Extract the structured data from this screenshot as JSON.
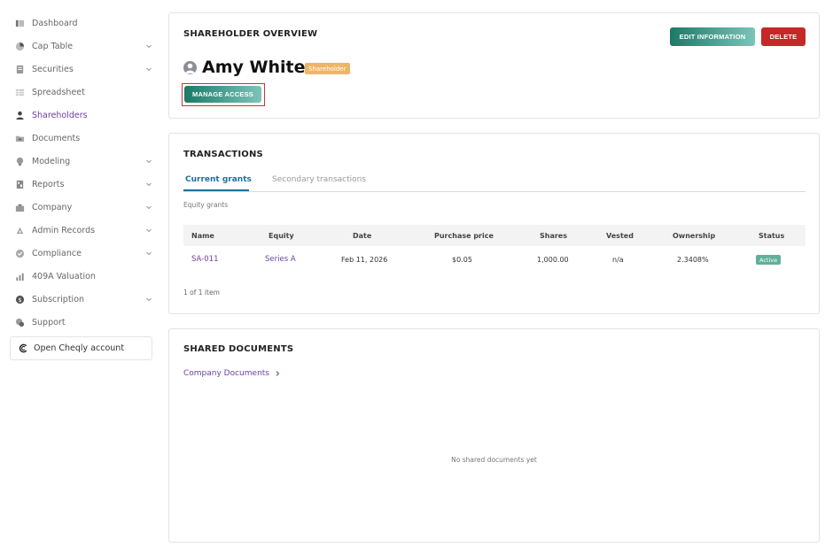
{
  "sidebar": {
    "items": [
      {
        "label": "Dashboard",
        "icon": "dashboard-icon",
        "chevron": false,
        "active": false
      },
      {
        "label": "Cap Table",
        "icon": "pie-chart-icon",
        "chevron": true,
        "active": false
      },
      {
        "label": "Securities",
        "icon": "securities-icon",
        "chevron": true,
        "active": false
      },
      {
        "label": "Spreadsheet",
        "icon": "spreadsheet-icon",
        "chevron": false,
        "active": false
      },
      {
        "label": "Shareholders",
        "icon": "person-icon",
        "chevron": false,
        "active": true
      },
      {
        "label": "Documents",
        "icon": "folder-icon",
        "chevron": false,
        "active": false
      },
      {
        "label": "Modeling",
        "icon": "lightbulb-icon",
        "chevron": true,
        "active": false
      },
      {
        "label": "Reports",
        "icon": "reports-icon",
        "chevron": true,
        "active": false
      },
      {
        "label": "Company",
        "icon": "company-icon",
        "chevron": true,
        "active": false
      },
      {
        "label": "Admin Records",
        "icon": "admin-records-icon",
        "chevron": true,
        "active": false
      },
      {
        "label": "Compliance",
        "icon": "compliance-icon",
        "chevron": true,
        "active": false
      },
      {
        "label": "409A Valuation",
        "icon": "valuation-icon",
        "chevron": false,
        "active": false
      },
      {
        "label": "Subscription",
        "icon": "subscription-icon",
        "chevron": true,
        "active": false
      },
      {
        "label": "Support",
        "icon": "support-icon",
        "chevron": false,
        "active": false
      }
    ],
    "open_account_label": "Open Cheqly account"
  },
  "overview": {
    "title": "SHAREHOLDER OVERVIEW",
    "edit_label": "EDIT INFORMATION",
    "delete_label": "DELETE",
    "name": "Amy White",
    "role_badge": "Shareholder",
    "manage_label": "MANAGE ACCESS"
  },
  "transactions": {
    "title": "TRANSACTIONS",
    "tabs": [
      "Current grants",
      "Secondary transactions"
    ],
    "section_label": "Equity grants",
    "columns": [
      "Name",
      "Equity",
      "Date",
      "Purchase price",
      "Shares",
      "Vested",
      "Ownership",
      "Status"
    ],
    "rows": [
      {
        "name": "SA-011",
        "equity": "Series A",
        "date": "Feb 11, 2026",
        "price": "$0.05",
        "shares": "1,000.00",
        "vested": "n/a",
        "ownership": "2.3408%",
        "status": "Active"
      }
    ],
    "pager": "1 of 1 item"
  },
  "shared_documents": {
    "title": "SHARED DOCUMENTS",
    "link_label": "Company Documents",
    "empty_text": "No shared documents yet"
  },
  "colors": {
    "accent_purple": "#6b3fa0",
    "teal": "#1a7a66",
    "delete_red": "#c62828",
    "badge_orange": "#eeb566",
    "active_green": "#5fb09a"
  }
}
